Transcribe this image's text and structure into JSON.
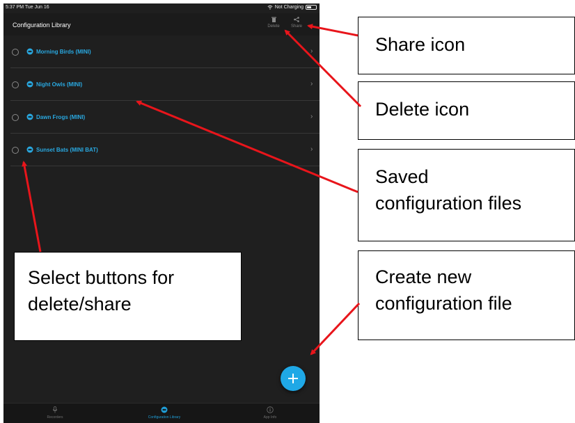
{
  "status_bar": {
    "time": "5:37 PM  Tue Jun 16",
    "charging": "Not Charging"
  },
  "nav": {
    "title": "Configuration Library",
    "delete_label": "Delete",
    "share_label": "Share"
  },
  "files": [
    {
      "label": "Morning Birds (MINI)"
    },
    {
      "label": "Night Owls (MINI)"
    },
    {
      "label": "Dawn Frogs (MINI)"
    },
    {
      "label": "Sunset Bats (MINI BAT)"
    }
  ],
  "tabs": [
    {
      "label": "Recorders",
      "icon": "microphone-icon"
    },
    {
      "label": "Configuration Library",
      "icon": "bat-icon",
      "active": true
    },
    {
      "label": "App Info",
      "icon": "info-icon"
    }
  ],
  "annotations": {
    "share_icon": "Share icon",
    "delete_icon": "Delete icon",
    "saved_line1": "Saved",
    "saved_line2": "configuration files",
    "create_line1": "Create new",
    "create_line2": "configuration file",
    "select_line1": "Select buttons for",
    "select_line2": "delete/share"
  },
  "colors": {
    "accent": "#1fa8e6",
    "link": "#29a8e0",
    "arrow": "#e8151b",
    "background": "#1f1f1f"
  }
}
